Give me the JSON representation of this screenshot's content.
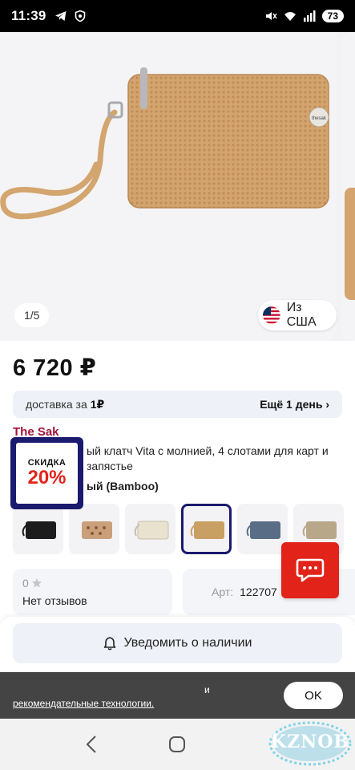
{
  "status_bar": {
    "time": "11:39",
    "battery": "73"
  },
  "gallery": {
    "counter": "1/5",
    "origin_label": "Из США"
  },
  "product": {
    "price": "6 720 ₽",
    "delivery_label": "доставка за",
    "delivery_price": "1₽",
    "delivery_more": "Ещё 1 день",
    "brand": "The Sak",
    "title": "ый клатч Vita с молнией, 4 слотами для карт и запястье",
    "color_label": "ый (Bamboo)"
  },
  "discount": {
    "label": "СКИДКА",
    "percent": "20%"
  },
  "reviews": {
    "rating": "0",
    "text": "Нет отзывов"
  },
  "article": {
    "label": "Арт:",
    "value": "122707"
  },
  "notify": {
    "label": "Уведомить о наличии"
  },
  "cookie": {
    "and_text": "и",
    "link_text": "рекомендательные технологии",
    "period": ".",
    "ok_label": "OK"
  },
  "watermark": {
    "text": "KZNOB"
  },
  "thumbnails": [
    {
      "color": "#1c1c1c",
      "name": "black"
    },
    {
      "color": "#c9a07a",
      "name": "tan-pattern"
    },
    {
      "color": "#e8e2cf",
      "name": "cream"
    },
    {
      "color": "#c9a063",
      "name": "bamboo"
    },
    {
      "color": "#5a6d86",
      "name": "blue"
    },
    {
      "color": "#b9a78a",
      "name": "natural"
    }
  ],
  "colors": {
    "brand": "#a3123a",
    "discount_frame": "#1a1a6e",
    "discount_red": "#e2231a",
    "chat": "#e2231a"
  }
}
